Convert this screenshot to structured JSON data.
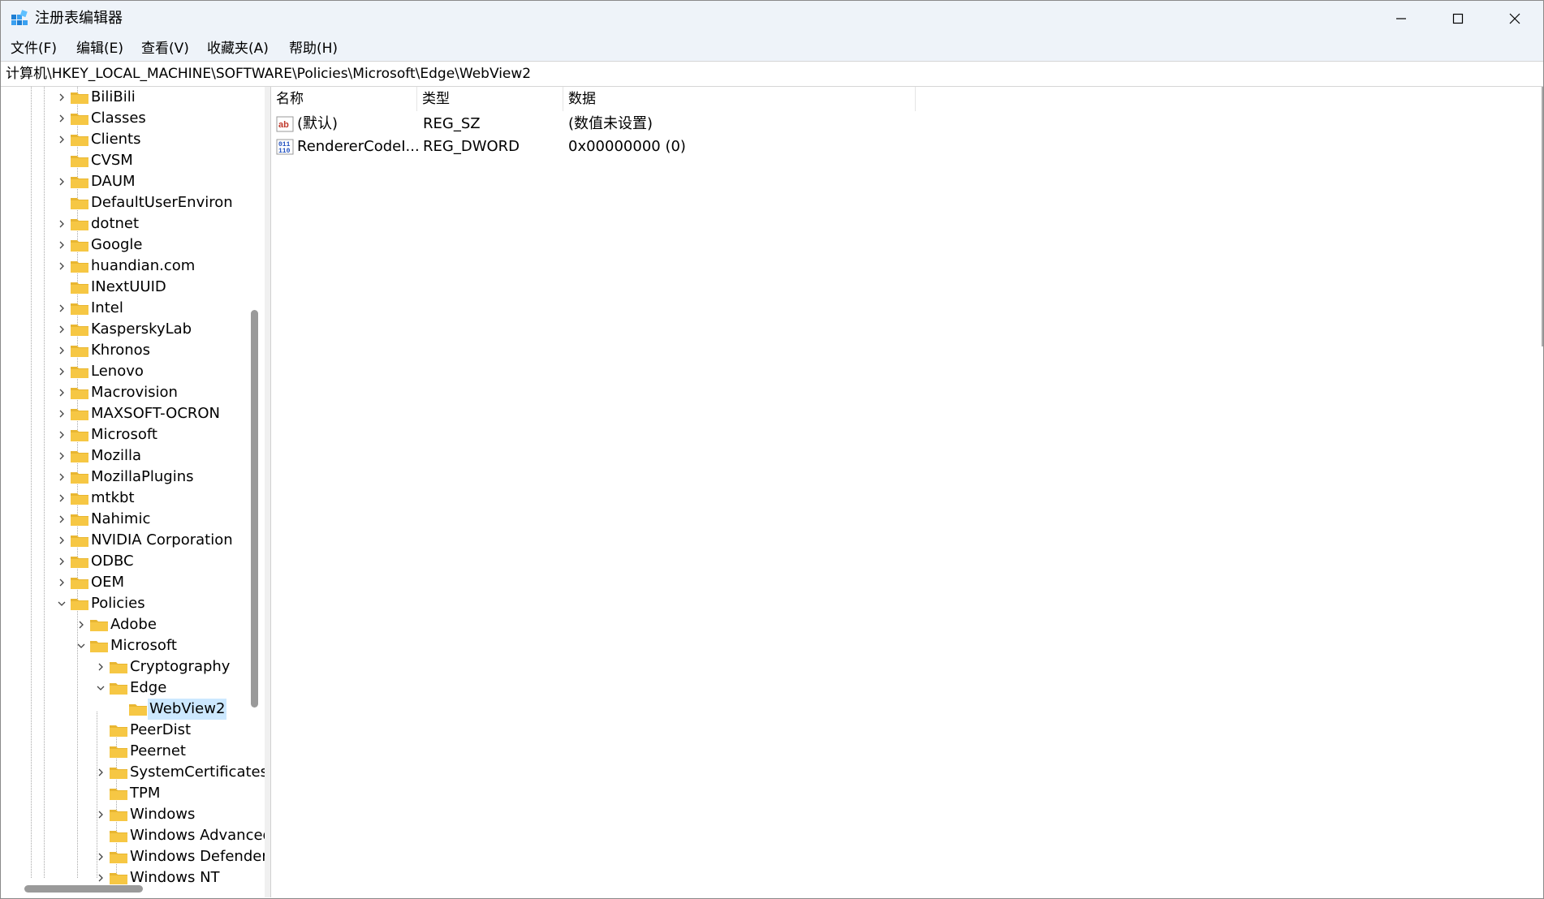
{
  "window": {
    "title": "注册表编辑器",
    "buttons": {
      "minimize": "—",
      "maximize": "☐",
      "close": "✕"
    }
  },
  "menu": [
    {
      "label": "文件(F)"
    },
    {
      "label": "编辑(E)"
    },
    {
      "label": "查看(V)"
    },
    {
      "label": "收藏夹(A)"
    },
    {
      "label": "帮助(H)"
    }
  ],
  "address": "计算机\\HKEY_LOCAL_MACHINE\\SOFTWARE\\Policies\\Microsoft\\Edge\\WebView2",
  "tree": [
    {
      "label": "BiliBili",
      "depth": 0,
      "arrow": "right"
    },
    {
      "label": "Classes",
      "depth": 0,
      "arrow": "right"
    },
    {
      "label": "Clients",
      "depth": 0,
      "arrow": "right"
    },
    {
      "label": "CVSM",
      "depth": 0,
      "arrow": "none"
    },
    {
      "label": "DAUM",
      "depth": 0,
      "arrow": "right"
    },
    {
      "label": "DefaultUserEnviron",
      "depth": 0,
      "arrow": "none"
    },
    {
      "label": "dotnet",
      "depth": 0,
      "arrow": "right"
    },
    {
      "label": "Google",
      "depth": 0,
      "arrow": "right"
    },
    {
      "label": "huandian.com",
      "depth": 0,
      "arrow": "right"
    },
    {
      "label": "INextUUID",
      "depth": 0,
      "arrow": "none"
    },
    {
      "label": "Intel",
      "depth": 0,
      "arrow": "right"
    },
    {
      "label": "KasperskyLab",
      "depth": 0,
      "arrow": "right"
    },
    {
      "label": "Khronos",
      "depth": 0,
      "arrow": "right"
    },
    {
      "label": "Lenovo",
      "depth": 0,
      "arrow": "right"
    },
    {
      "label": "Macrovision",
      "depth": 0,
      "arrow": "right"
    },
    {
      "label": "MAXSOFT-OCRON",
      "depth": 0,
      "arrow": "right"
    },
    {
      "label": "Microsoft",
      "depth": 0,
      "arrow": "right"
    },
    {
      "label": "Mozilla",
      "depth": 0,
      "arrow": "right"
    },
    {
      "label": "MozillaPlugins",
      "depth": 0,
      "arrow": "right"
    },
    {
      "label": "mtkbt",
      "depth": 0,
      "arrow": "right"
    },
    {
      "label": "Nahimic",
      "depth": 0,
      "arrow": "right"
    },
    {
      "label": "NVIDIA Corporation",
      "depth": 0,
      "arrow": "right"
    },
    {
      "label": "ODBC",
      "depth": 0,
      "arrow": "right"
    },
    {
      "label": "OEM",
      "depth": 0,
      "arrow": "right"
    },
    {
      "label": "Policies",
      "depth": 0,
      "arrow": "down"
    },
    {
      "label": "Adobe",
      "depth": 1,
      "arrow": "right"
    },
    {
      "label": "Microsoft",
      "depth": 1,
      "arrow": "down"
    },
    {
      "label": "Cryptography",
      "depth": 2,
      "arrow": "right"
    },
    {
      "label": "Edge",
      "depth": 2,
      "arrow": "down"
    },
    {
      "label": "WebView2",
      "depth": 3,
      "arrow": "none",
      "selected": true
    },
    {
      "label": "PeerDist",
      "depth": 2,
      "arrow": "none"
    },
    {
      "label": "Peernet",
      "depth": 2,
      "arrow": "none"
    },
    {
      "label": "SystemCertificates",
      "depth": 2,
      "arrow": "right"
    },
    {
      "label": "TPM",
      "depth": 2,
      "arrow": "none"
    },
    {
      "label": "Windows",
      "depth": 2,
      "arrow": "right"
    },
    {
      "label": "Windows Advanced",
      "depth": 2,
      "arrow": "none"
    },
    {
      "label": "Windows Defender",
      "depth": 2,
      "arrow": "right"
    },
    {
      "label": "Windows NT",
      "depth": 2,
      "arrow": "right"
    }
  ],
  "columns": {
    "name": "名称",
    "type": "类型",
    "data": "数据"
  },
  "values": [
    {
      "name": "(默认)",
      "type": "REG_SZ",
      "data": "(数值未设置)",
      "icon": "string-value-icon"
    },
    {
      "name": "RendererCodeI...",
      "type": "REG_DWORD",
      "data": "0x00000000 (0)",
      "icon": "binary-value-icon"
    }
  ],
  "colors": {
    "folder": "#f6c744",
    "selection": "#cce8ff",
    "titlebar": "#eef3f9"
  }
}
